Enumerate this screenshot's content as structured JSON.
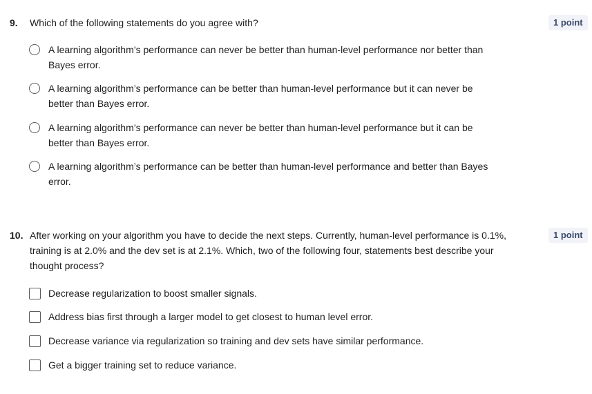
{
  "q9": {
    "number": "9.",
    "text": "Which of the following statements do you agree with?",
    "points": "1 point",
    "options": [
      "A learning algorithm’s performance can never be better than human-level performance nor better than Bayes error.",
      "A learning algorithm’s performance can be better than human-level performance but it can never be better than Bayes error.",
      "A learning algorithm’s performance can never be better than human-level performance but it can be better than Bayes error.",
      "A learning algorithm’s performance can be better than human-level performance and better than Bayes error."
    ]
  },
  "q10": {
    "number": "10.",
    "text": "After working on your algorithm you have to decide the next steps. Currently, human-level performance is 0.1%, training is at 2.0% and the dev set is at 2.1%. Which, two of the following four, statements best describe your thought process?",
    "points": "1 point",
    "options": [
      "Decrease regularization to boost smaller signals.",
      "Address bias first through a larger model to get closest to human level error.",
      "Decrease variance via regularization so training and dev sets have similar performance.",
      "Get a bigger training set to reduce variance."
    ]
  },
  "colors": {
    "text": "#1f1f1f",
    "badge_bg": "#f1f3f8",
    "badge_text": "#3b4a6b",
    "control_border": "#5b5b5b"
  },
  "icons": {
    "radio": "radio-button-unselected-icon",
    "checkbox": "checkbox-unchecked-icon"
  }
}
